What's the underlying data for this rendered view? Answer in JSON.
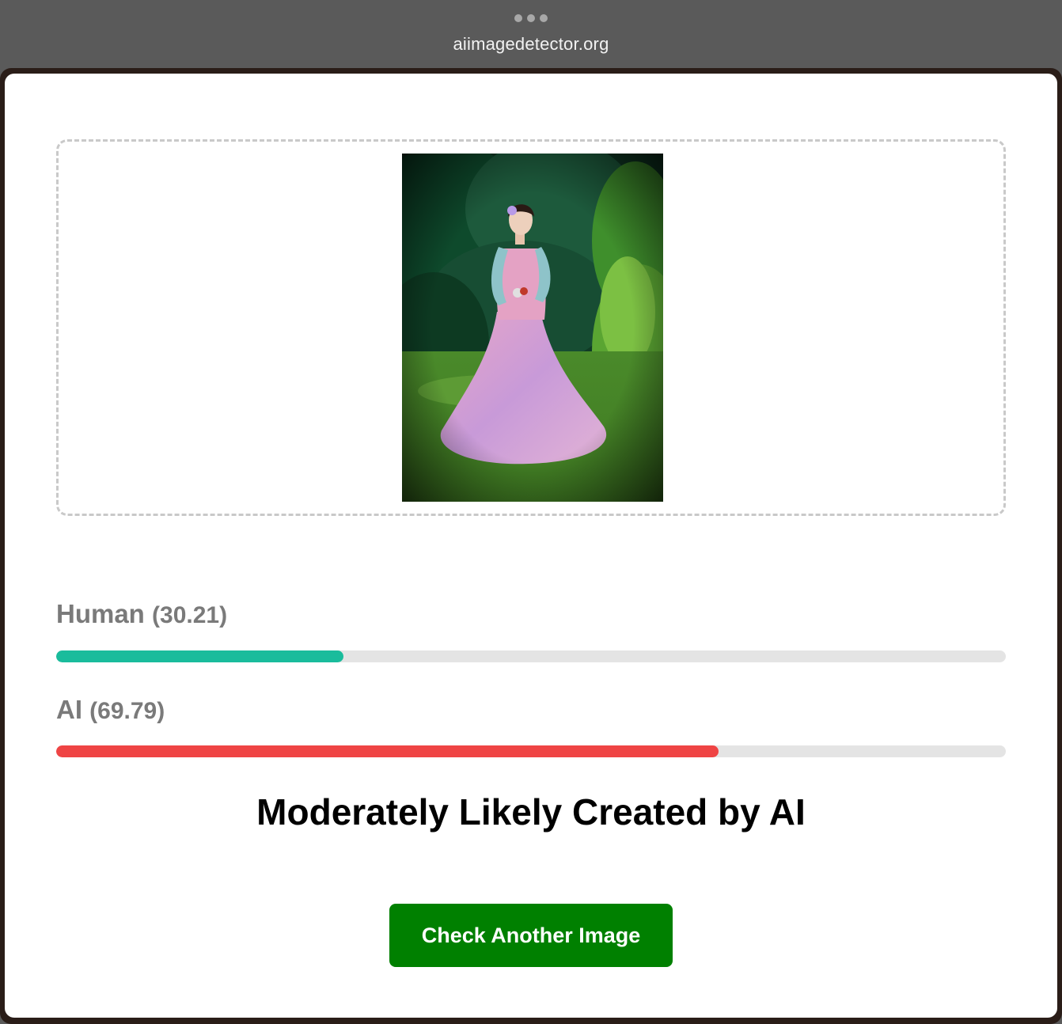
{
  "browser": {
    "url": "aiimagedetector.org"
  },
  "upload": {
    "image_icon": "uploaded-photo"
  },
  "results": {
    "human": {
      "label": "Human",
      "score_text": "(30.21)",
      "percent": 30.21,
      "color": "#1abc9c"
    },
    "ai": {
      "label": "AI",
      "score_text": "(69.79)",
      "percent": 69.79,
      "color": "#ef4444"
    },
    "verdict": "Moderately Likely Created by AI"
  },
  "actions": {
    "check_another_label": "Check Another Image",
    "button_color": "#008000"
  }
}
